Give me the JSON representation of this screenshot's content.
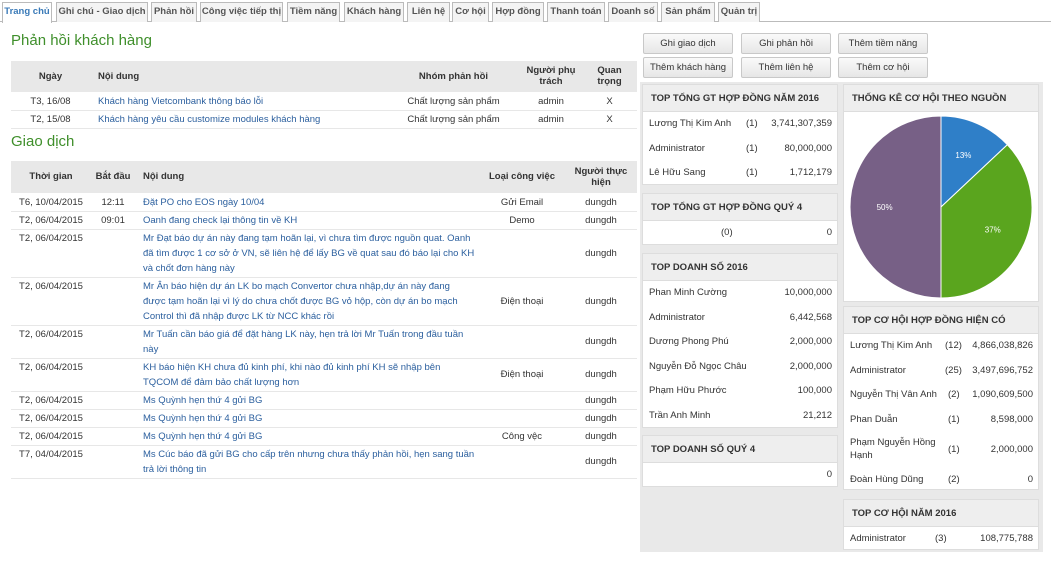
{
  "tabs": [
    "Trang chủ",
    "Ghi chú - Giao dịch",
    "Phản hồi",
    "Công việc tiếp thị",
    "Tiềm năng",
    "Khách hàng",
    "Liên hệ",
    "Cơ hội",
    "Hợp đồng",
    "Thanh toán",
    "Doanh số",
    "Sản phẩm",
    "Quản trị"
  ],
  "feedback": {
    "title": "Phản hồi khách hàng",
    "headers": {
      "date": "Ngày",
      "content": "Nội dung",
      "group": "Nhóm phản hồi",
      "owner": "Người phụ trách",
      "important": "Quan trọng"
    },
    "rows": [
      {
        "date": "T3, 16/08",
        "content": "Khách hàng Vietcombank thông báo lỗi",
        "group": "Chất lượng sản phẩm",
        "owner": "admin",
        "important": "X"
      },
      {
        "date": "T2, 15/08",
        "content": "Khách hàng yêu cầu customize modules khách hàng",
        "group": "Chất lượng sản phẩm",
        "owner": "admin",
        "important": "X"
      }
    ]
  },
  "transactions": {
    "title": "Giao dịch",
    "headers": {
      "time": "Thời gian",
      "start": "Bắt đầu",
      "content": "Nội dung",
      "type": "Loại công việc",
      "performer": "Người thực hiện"
    },
    "rows": [
      {
        "time": "T6, 10/04/2015",
        "start": "12:11",
        "content": "Đặt PO cho EOS ngày 10/04",
        "type": "Gửi Email",
        "performer": "dungdh"
      },
      {
        "time": "T2, 06/04/2015",
        "start": "09:01",
        "content": "Oanh đang check lại thông tin về KH",
        "type": "Demo",
        "performer": "dungdh"
      },
      {
        "time": "T2, 06/04/2015",
        "start": "",
        "content": "Mr Đạt báo dự án này đang tạm hoãn lại, vì chưa tìm được nguồn quat. Oanh đã tìm được 1 cơ sở ở VN, sẽ liên hệ để lấy BG về quat sau đó báo lại cho KH và chốt đơn hàng này",
        "type": "",
        "performer": "dungdh"
      },
      {
        "time": "T2, 06/04/2015",
        "start": "",
        "content": "Mr Ân báo hiện dự án LK bo mạch Convertor chưa nhập,dự án này đang được tạm hoãn lại vì lý do chưa chốt được BG vỏ hộp, còn dự án bo mạch Control thì đã nhập được LK từ NCC khác rồi",
        "type": "Điện thoại",
        "performer": "dungdh"
      },
      {
        "time": "T2, 06/04/2015",
        "start": "",
        "content": "Mr Tuấn cần báo giá để đặt hàng LK này, hẹn trả lời Mr Tuấn trong đầu tuần này",
        "type": "",
        "performer": "dungdh"
      },
      {
        "time": "T2, 06/04/2015",
        "start": "",
        "content": "KH báo hiện KH chưa đủ kinh phí, khi nào đủ kinh phí KH sẽ nhập bên TQCOM để đảm bảo chất lượng hơn",
        "type": "Điện thoại",
        "performer": "dungdh"
      },
      {
        "time": "T2, 06/04/2015",
        "start": "",
        "content": "Ms Quỳnh hẹn thứ 4 gửi BG",
        "type": "",
        "performer": "dungdh"
      },
      {
        "time": "T2, 06/04/2015",
        "start": "",
        "content": "Ms Quỳnh hẹn thứ 4 gửi BG",
        "type": "",
        "performer": "dungdh"
      },
      {
        "time": "T2, 06/04/2015",
        "start": "",
        "content": "Ms Quỳnh hẹn thứ 4 gửi BG",
        "type": "Công vệc",
        "performer": "dungdh"
      },
      {
        "time": "T7, 04/04/2015",
        "start": "",
        "content": "Ms Cúc báo đã gửi BG cho cấp trên nhưng chưa thấy phản hồi, hẹn sang tuần trả lời thông tin",
        "type": "",
        "performer": "dungdh"
      }
    ]
  },
  "buttons": [
    "Ghi giao dịch",
    "Ghi phản hồi",
    "Thêm tiềm năng",
    "Thêm khách hàng",
    "Thêm liên hệ",
    "Thêm cơ hội"
  ],
  "p_contract_year": {
    "title": "TOP TỔNG GT HỢP ĐỒNG NĂM 2016",
    "rows": [
      {
        "name": "Lương Thị Kim Anh",
        "count": "(1)",
        "value": "3,741,307,359"
      },
      {
        "name": "Administrator",
        "count": "(1)",
        "value": "80,000,000"
      },
      {
        "name": "Lê Hữu Sang",
        "count": "(1)",
        "value": "1,712,179"
      }
    ]
  },
  "p_contract_q4": {
    "title": "TOP TỔNG GT HỢP ĐỒNG QUÝ 4",
    "rows": [
      {
        "name": "",
        "count": "(0)",
        "value": "0"
      }
    ]
  },
  "p_sales_year": {
    "title": "TOP DOANH SỐ 2016",
    "rows": [
      {
        "name": "Phan Minh Cường",
        "value": "10,000,000"
      },
      {
        "name": "Administrator",
        "value": "6,442,568"
      },
      {
        "name": "Dương Phong Phú",
        "value": "2,000,000"
      },
      {
        "name": "Nguyễn Đỗ Ngọc Châu",
        "value": "2,000,000"
      },
      {
        "name": "Phạm Hữu Phước",
        "value": "100,000"
      },
      {
        "name": "Trần Anh Minh",
        "value": "21,212"
      }
    ]
  },
  "p_sales_q4": {
    "title": "TOP DOANH SỐ QUÝ 4",
    "rows": [
      {
        "value": "0"
      }
    ]
  },
  "p_pie": {
    "title": "THỐNG KÊ CƠ HỘI THEO NGUỒN"
  },
  "chart_data": {
    "type": "pie",
    "title": "THỐNG KÊ CƠ HỘI THEO NGUỒN",
    "labels": [
      "13%",
      "37%",
      "50%"
    ],
    "values": [
      13,
      37,
      50
    ],
    "colors": [
      "#2f7fc8",
      "#5aa51e",
      "#776086"
    ]
  },
  "p_opp_contract": {
    "title": "TOP CƠ HỘI HỢP ĐỒNG HIỆN CÓ",
    "rows": [
      {
        "name": "Lương Thị Kim Anh",
        "count": "(12)",
        "value": "4,866,038,826"
      },
      {
        "name": "Administrator",
        "count": "(25)",
        "value": "3,497,696,752"
      },
      {
        "name": "Nguyễn Thị Vân Anh",
        "count": "(2)",
        "value": "1,090,609,500"
      },
      {
        "name": "Phan Duẫn",
        "count": "(1)",
        "value": "8,598,000"
      },
      {
        "name": "Phạm Nguyễn Hồng Hạnh",
        "count": "(1)",
        "value": "2,000,000"
      },
      {
        "name": "Đoàn Hùng Dũng",
        "count": "(2)",
        "value": "0"
      }
    ]
  },
  "p_opp_year": {
    "title": "TOP CƠ HỘI NĂM 2016",
    "rows": [
      {
        "name": "Administrator",
        "count": "(3)",
        "value": "108,775,788"
      }
    ]
  }
}
